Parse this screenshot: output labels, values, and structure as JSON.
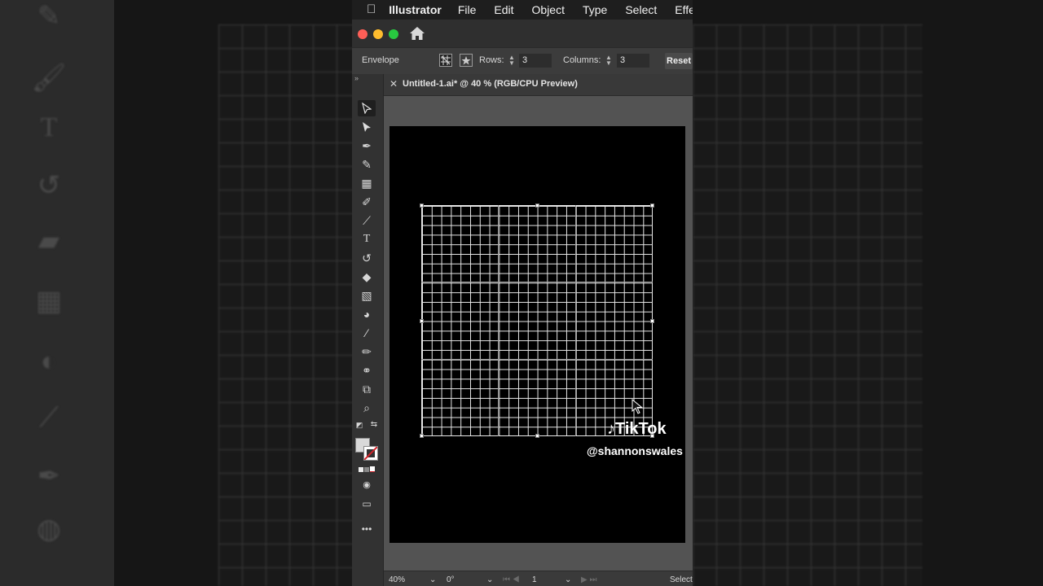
{
  "menubar": {
    "app_name": "Illustrator",
    "items": [
      "File",
      "Edit",
      "Object",
      "Type",
      "Select",
      "Effect"
    ]
  },
  "control_bar": {
    "mode_label": "Envelope",
    "rows_label": "Rows:",
    "rows_value": "3",
    "columns_label": "Columns:",
    "columns_value": "3",
    "reset_label": "Reset"
  },
  "document_tab": {
    "title": "Untitled-1.ai* @ 40 % (RGB/CPU Preview)"
  },
  "statusbar": {
    "zoom": "40%",
    "rotation": "0°",
    "artboard_number": "1",
    "tool_name": "Select"
  },
  "watermark": {
    "logo_text": "TikTok",
    "username": "@shannonswales"
  },
  "colors": {
    "menubar_bg": "#1e1e1e",
    "panel_bg": "#323232",
    "artboard_bg": "#000000",
    "grid_lines": "#e8e8e8"
  }
}
